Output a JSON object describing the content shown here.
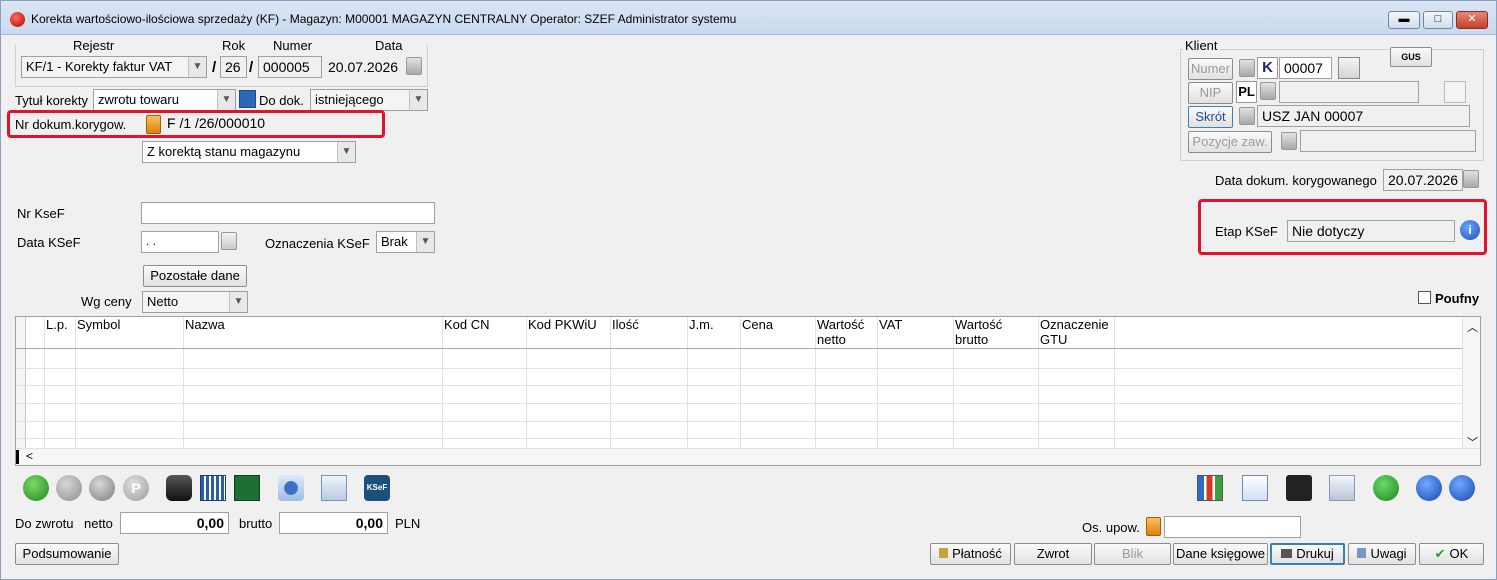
{
  "window": {
    "title": "Korekta wartościowo-ilościowa sprzedaży (KF) - Magazyn: M00001 MAGAZYN CENTRALNY  Operator: SZEF Administrator systemu",
    "minimize": "▬",
    "maximize": "□",
    "close": "✕"
  },
  "header": {
    "rejestr_label": "Rejestr",
    "rejestr_value": "KF/1   - Korekty faktur VAT",
    "rok_label": "Rok",
    "rok_value": "26",
    "slash": "/",
    "numer_label": "Numer",
    "numer_value": "000005",
    "data_label": "Data",
    "data_value": "20.07.2026",
    "tytul_label": "Tytuł korekty",
    "tytul_value": "zwrotu towaru",
    "do_dok_label": "Do dok.",
    "do_dok_value": "istniejącego",
    "nr_dok_label": "Nr dokum.korygow.",
    "nr_dok_value": "F /1  /26/000010",
    "magazyn_option": "Z korektą stanu magazynu"
  },
  "ksef": {
    "nr_label": "Nr KseF",
    "nr_value": "",
    "data_label": "Data KSeF",
    "data_value": " .  .",
    "oznaczenia_label": "Oznaczenia KSeF",
    "oznaczenia_value": "Brak",
    "pozostale_button": "Pozostałe dane",
    "wg_ceny_label": "Wg ceny",
    "wg_ceny_value": "Netto",
    "etap_label": "Etap KSeF",
    "etap_value": "Nie dotyczy"
  },
  "klient": {
    "label": "Klient",
    "numer_button": "Numer",
    "k_badge": "K",
    "numer_value": "00007",
    "gus_button": "GUS",
    "nip_button": "NIP",
    "nip_prefix": "PL",
    "nip_value": "",
    "skrot_button": "Skrót",
    "skrot_value": "USZ JAN 00007",
    "pozycje_button": "Pozycje zaw.",
    "pozycje_value": "",
    "data_kor_label": "Data dokum. korygowanego",
    "data_kor_value": "20.07.2026",
    "poufny_label": "Poufny"
  },
  "grid": {
    "columns": [
      "L.p.",
      "Symbol",
      "Nazwa",
      "Kod CN",
      "Kod PKWiU",
      "Ilość",
      "J.m.",
      "Cena",
      "Wartość netto",
      "VAT",
      "Wartość brutto",
      "Oznaczenie GTU"
    ],
    "scroll_up": "︿",
    "scroll_down": "﹀",
    "scroll_left": "<"
  },
  "totals": {
    "do_zwrotu_label": "Do zwrotu",
    "netto_label": "netto",
    "netto_value": "0,00",
    "brutto_label": "brutto",
    "brutto_value": "0,00",
    "currency": "PLN",
    "os_upow_label": "Os. upow.",
    "os_upow_value": ""
  },
  "buttons": {
    "podsumowanie": "Podsumowanie",
    "platnosc": "Płatność",
    "zwrot": "Zwrot",
    "blik": "Blik",
    "dane_ksiegowe": "Dane księgowe",
    "drukuj": "Drukuj",
    "uwagi": "Uwagi",
    "ok": "OK"
  },
  "toolbar_badges": {
    "p_badge": "P",
    "ksef_badge": "KSeF"
  }
}
